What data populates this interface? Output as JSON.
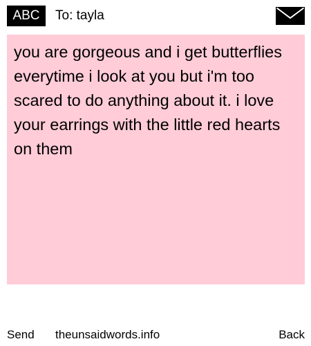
{
  "header": {
    "mode_badge": "ABC",
    "recipient_line": "To: tayla",
    "envelope_icon": "envelope-icon"
  },
  "message": {
    "text": "you are gorgeous and i get butterflies everytime i look at you but i'm too scared to do anything about it. i love your earrings with the little red hearts on them",
    "background_color": "#ffccd7"
  },
  "footer": {
    "send_label": "Send",
    "site_label": "theunsaidwords.info",
    "back_label": "Back"
  }
}
